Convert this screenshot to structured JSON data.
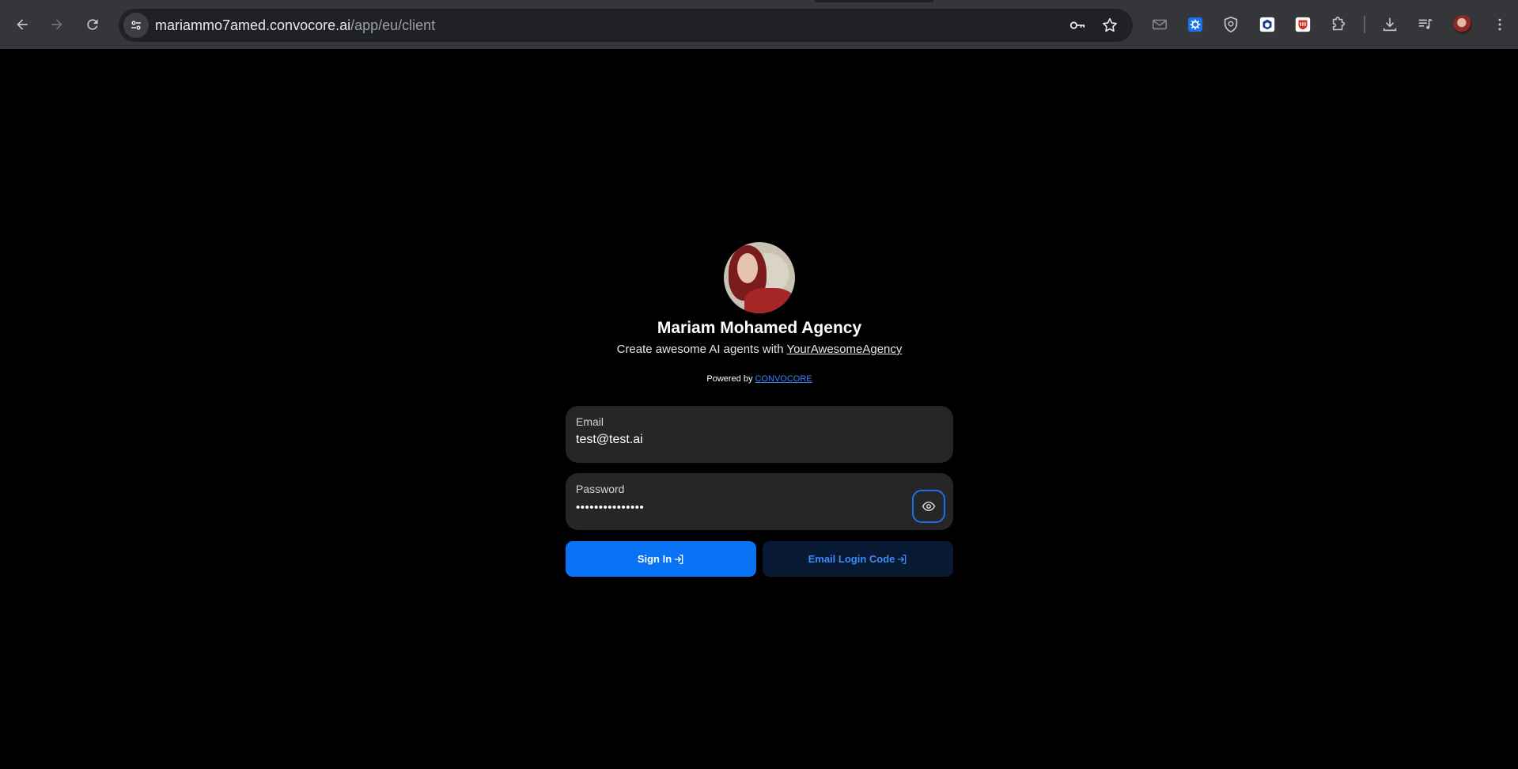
{
  "browser": {
    "url_host": "mariammo7amed.convocore.ai",
    "url_path": "/app/eu/client"
  },
  "login": {
    "agency_name": "Mariam Mohamed Agency",
    "tagline_prefix": "Create awesome AI agents with ",
    "tagline_link": "YourAwesomeAgency",
    "powered_prefix": "Powered by ",
    "powered_link": "CONVOCORE",
    "email_label": "Email",
    "email_value": "test@test.ai",
    "password_label": "Password",
    "password_value": "•••••••••••••••",
    "signin_label": "Sign In",
    "email_code_label": "Email Login Code"
  },
  "colors": {
    "primary": "#0a72f5",
    "primary_dark": "#081a33",
    "field_bg": "#262626",
    "link": "#3b82f6"
  }
}
